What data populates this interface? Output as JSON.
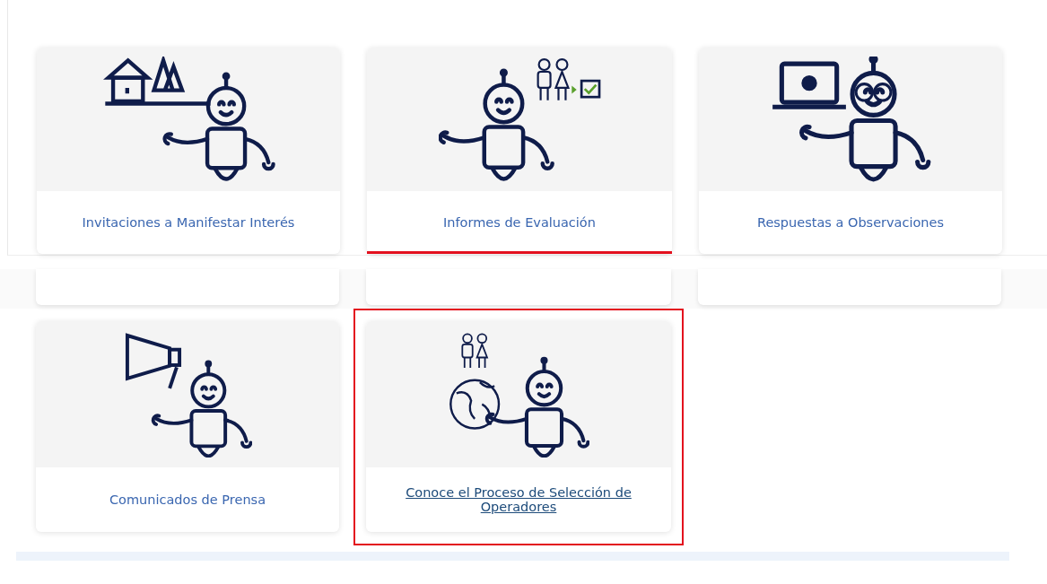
{
  "top_panel": {
    "cards": [
      {
        "kind": "house-trees",
        "label": "Invitaciones a Manifestar Interés",
        "highlighted": false
      },
      {
        "kind": "kids-check",
        "label": "Informes de Evaluación",
        "highlighted": true
      },
      {
        "kind": "laptop-glasses",
        "label": "Respuestas a Observaciones",
        "highlighted": false
      }
    ]
  },
  "bottom_panel": {
    "cards": [
      {
        "kind": "megaphone",
        "label": "Comunicados de Prensa",
        "highlighted": false
      },
      {
        "kind": "kids-globe",
        "label": "Conoce el Proceso de Selección de Operadores",
        "highlighted": true
      }
    ]
  }
}
